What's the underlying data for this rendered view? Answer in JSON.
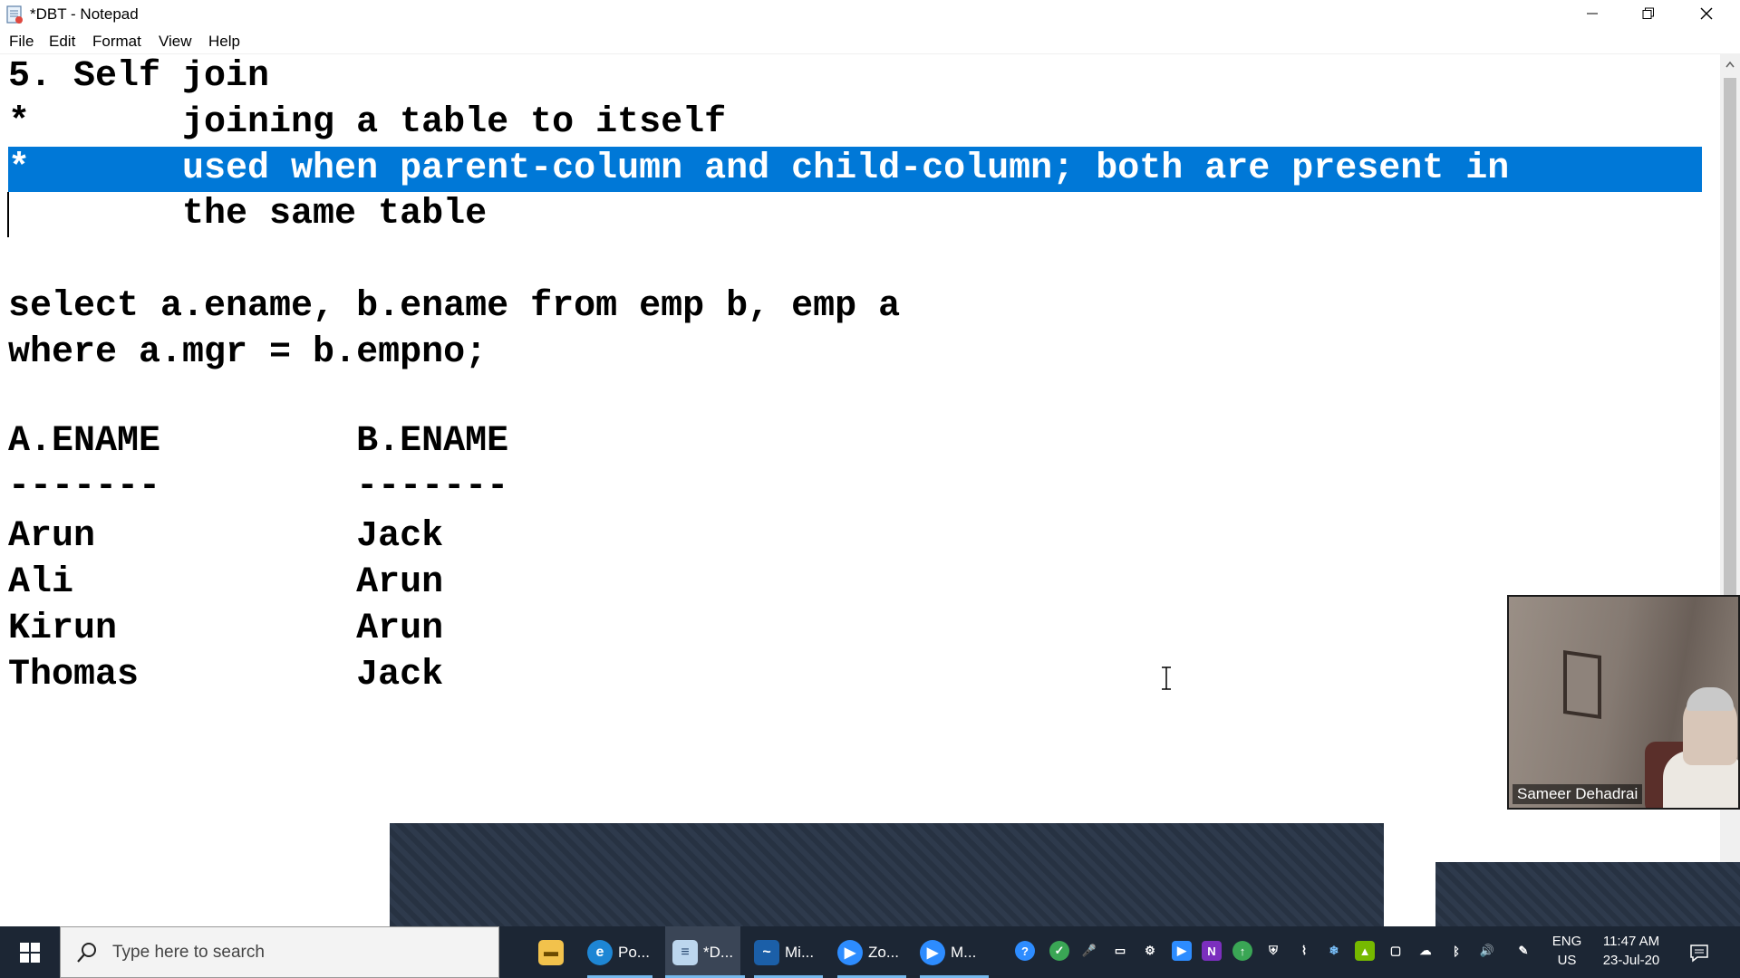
{
  "window": {
    "title": "*DBT - Notepad",
    "icon": "notepad-icon",
    "controls": [
      "minimize-icon",
      "maximize-icon",
      "close-icon"
    ]
  },
  "menu": {
    "file": "File",
    "edit": "Edit",
    "format": "Format",
    "view": "View",
    "help": "Help"
  },
  "editor": {
    "lines": [
      "5. Self join",
      "*       joining a table to itself",
      "*       used when parent-column and child-column; both are present in",
      "        the same table",
      "",
      "select a.ename, b.ename from emp b, emp a",
      "where a.mgr = b.empno;",
      "",
      "A.ENAME         B.ENAME",
      "-------         -------",
      "Arun            Jack",
      "Ali             Arun",
      "Kirun           Arun",
      "Thomas          Jack"
    ],
    "selected_line_index": 2,
    "selection_color": "#0078d7"
  },
  "video": {
    "participant_name": "Sameer Dehadrai"
  },
  "taskbar": {
    "search_placeholder": "Type here to search",
    "apps": [
      {
        "icon": "file-explorer-icon",
        "label": ""
      },
      {
        "icon": "edge-icon",
        "label": "Po..."
      },
      {
        "icon": "notepad-icon",
        "label": "*D...",
        "active": true
      },
      {
        "icon": "whiteboard-icon",
        "label": "Mi..."
      },
      {
        "icon": "zoom-icon",
        "label": "Zo..."
      },
      {
        "icon": "zoom-meeting-icon",
        "label": "M..."
      }
    ],
    "language": {
      "top": "ENG",
      "bottom": "US"
    },
    "clock": {
      "time": "11:47 AM",
      "date": "23-Jul-20"
    }
  },
  "colors": {
    "taskbar": "#1c2634",
    "accent": "#0078d7"
  }
}
